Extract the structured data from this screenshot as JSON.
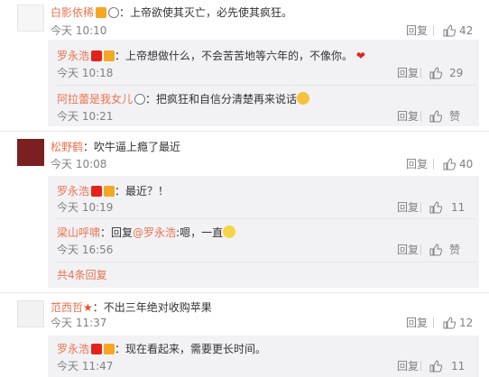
{
  "comments": [
    {
      "name": "白影依稀",
      "text": "：上帝欲使其灭亡，必先使其疯狂。",
      "time": "今天 10:10",
      "reply_label": "回复",
      "like_count": "42",
      "replies": [
        {
          "name": "罗永浩",
          "text": "：上帝想做什么，不会苦苦地等六年的，不像你。",
          "time": "今天 10:18",
          "reply_label": "回复",
          "like_count": "29"
        },
        {
          "name": "阿拉蕾是我女儿",
          "text": "：把疯狂和自信分清楚再来说话",
          "time": "今天 10:21",
          "reply_label": "回复",
          "like_count": "赞"
        }
      ]
    },
    {
      "name": "松野鹤",
      "text": "：吹牛逼上瘾了最近",
      "time": "今天 10:08",
      "reply_label": "回复",
      "like_count": "40",
      "replies": [
        {
          "name": "罗永浩",
          "text": "：最近？！",
          "time": "今天 10:19",
          "reply_label": "回复",
          "like_count": "11"
        },
        {
          "name": "梁山呼啸",
          "text": "：回复",
          "mention": "@罗永浩",
          "text2": ":嗯，一直",
          "time": "今天 16:56",
          "reply_label": "回复",
          "like_count": "赞"
        }
      ],
      "more_replies": "共4条回复"
    },
    {
      "name": "范西哲",
      "text": "：不出三年绝对收购苹果",
      "time": "今天 11:37",
      "reply_label": "回复",
      "like_count": "12",
      "replies": [
        {
          "name": "罗永浩",
          "text": "：现在看起来，需要更长时间。",
          "time": "今天 11:47",
          "reply_label": "回复",
          "like_count": "11"
        }
      ]
    }
  ]
}
